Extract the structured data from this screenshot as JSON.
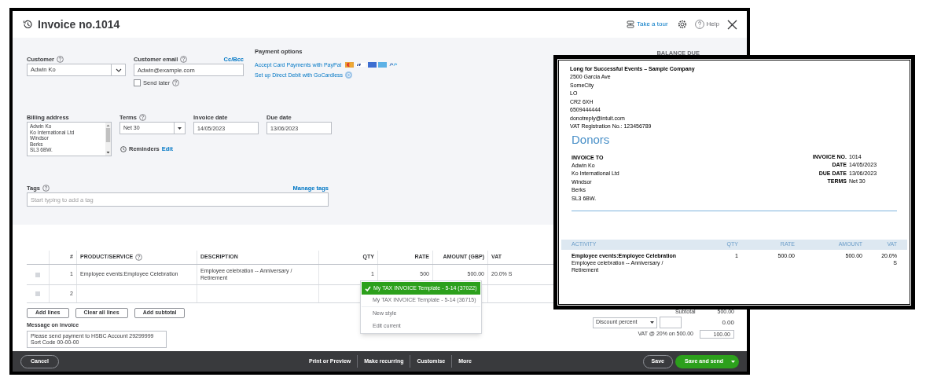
{
  "header": {
    "title": "Invoice no.1014",
    "tour": "Take a tour",
    "help": "Help"
  },
  "form": {
    "customer": {
      "label": "Customer",
      "help": true,
      "value": "Adwin Ko"
    },
    "email": {
      "label": "Customer email",
      "help": true,
      "value": "Adwin@example.com",
      "cc_link": "Cc/Bcc",
      "send_later": {
        "label": "Send later",
        "help": true,
        "checked": false
      }
    },
    "payment_options": {
      "title": "Payment options",
      "lines": [
        {
          "kind": "cards",
          "link": "Accept Card Payments",
          "text": "with PayPal"
        },
        {
          "kind": "gocardless",
          "link": "Set up Direct Debit",
          "text": "with GoCardless"
        }
      ]
    },
    "balance_due_label": "BALANCE DUE",
    "billing_address": {
      "label": "Billing address",
      "lines": [
        "Adwin Ko",
        "Ko International Ltd",
        "Windsor",
        "Berks",
        "SL3 6BW."
      ]
    },
    "terms": {
      "label": "Terms",
      "help": true,
      "value": "Net 30"
    },
    "invoice_date": {
      "label": "Invoice date",
      "value": "14/05/2023"
    },
    "due_date": {
      "label": "Due date",
      "value": "13/06/2023"
    },
    "reminders": {
      "label": "Reminders",
      "link": "Edit"
    },
    "tags": {
      "label": "Tags",
      "help": true,
      "manage_link": "Manage tags",
      "placeholder": "Start typing to add a tag"
    }
  },
  "line_items": {
    "columns": [
      {
        "label": "#",
        "help": false
      },
      {
        "label": "PRODUCT/SERVICE",
        "help": true
      },
      {
        "label": "DESCRIPTION",
        "help": false
      },
      {
        "label": "QTY",
        "help": false
      },
      {
        "label": "RATE",
        "help": false
      },
      {
        "label": "AMOUNT (GBP)",
        "help": false
      },
      {
        "label": "VAT",
        "help": false
      }
    ],
    "rows": [
      {
        "cells": [
          "1",
          "Employee events:Employee Celebration",
          "Employee celebration -- Anniversary / Retirement",
          "1",
          "500",
          "500.00",
          "20.0% S"
        ]
      },
      {
        "cells": [
          "2"
        ]
      }
    ]
  },
  "line_buttons": [
    "Add lines",
    "Clear all lines",
    "Add subtotal"
  ],
  "message": {
    "label": "Message on invoice",
    "value": "Please send payment to HSBC Account 29299999 Sort Code 00-00-00"
  },
  "totals": {
    "subtotal_label": "Subtotal",
    "subtotal": "500.00",
    "discount_type": "Discount percent",
    "discount_amount": "0.00",
    "vat_label": "VAT @ 20% on 500.00",
    "vat_amount": "100.00"
  },
  "footer": {
    "cancel": "Cancel",
    "actions": [
      "Print or Preview",
      "Make recurring",
      "Customise",
      "More"
    ],
    "save": "Save",
    "save_and_send": "Save and send"
  },
  "customise_menu": [
    {
      "label": "My TAX INVOICE Template - 5-14 (37022)",
      "selected": true
    },
    {
      "label": "My TAX INVOICE Template - 5-14 (36715)",
      "selected": false
    },
    {
      "label": "New style",
      "selected": false
    },
    {
      "label": "Edit current",
      "selected": false
    }
  ],
  "preview": {
    "company": "Long for Successful Events – Sample Company",
    "company_lines": [
      "2500 Garcia Ave",
      "SomeCity",
      "LO",
      "CR2 6XH",
      "6509444444",
      "donotreply@intuit.com",
      "VAT Registration No.: 123456789"
    ],
    "title": "Donors",
    "bill_to_label": "INVOICE TO",
    "bill_to": [
      "Adwin Ko",
      "Ko International Ltd",
      "Windsor",
      "Berks",
      "SL3 6BW."
    ],
    "meta": [
      {
        "label": "INVOICE NO.",
        "value": "1014"
      },
      {
        "label": "DATE",
        "value": "14/05/2023"
      },
      {
        "label": "DUE DATE",
        "value": "13/06/2023"
      },
      {
        "label": "TERMS",
        "value": "Net 30"
      }
    ],
    "columns": [
      "ACTIVITY",
      "QTY",
      "RATE",
      "AMOUNT",
      "VAT"
    ],
    "rows": [
      {
        "activity": "Employee events:Employee Celebration",
        "description": "Employee celebration -- Anniversary / Retirement",
        "qty": "1",
        "rate": "500.00",
        "amount": "500.00",
        "vat": "20.0% S"
      }
    ]
  }
}
